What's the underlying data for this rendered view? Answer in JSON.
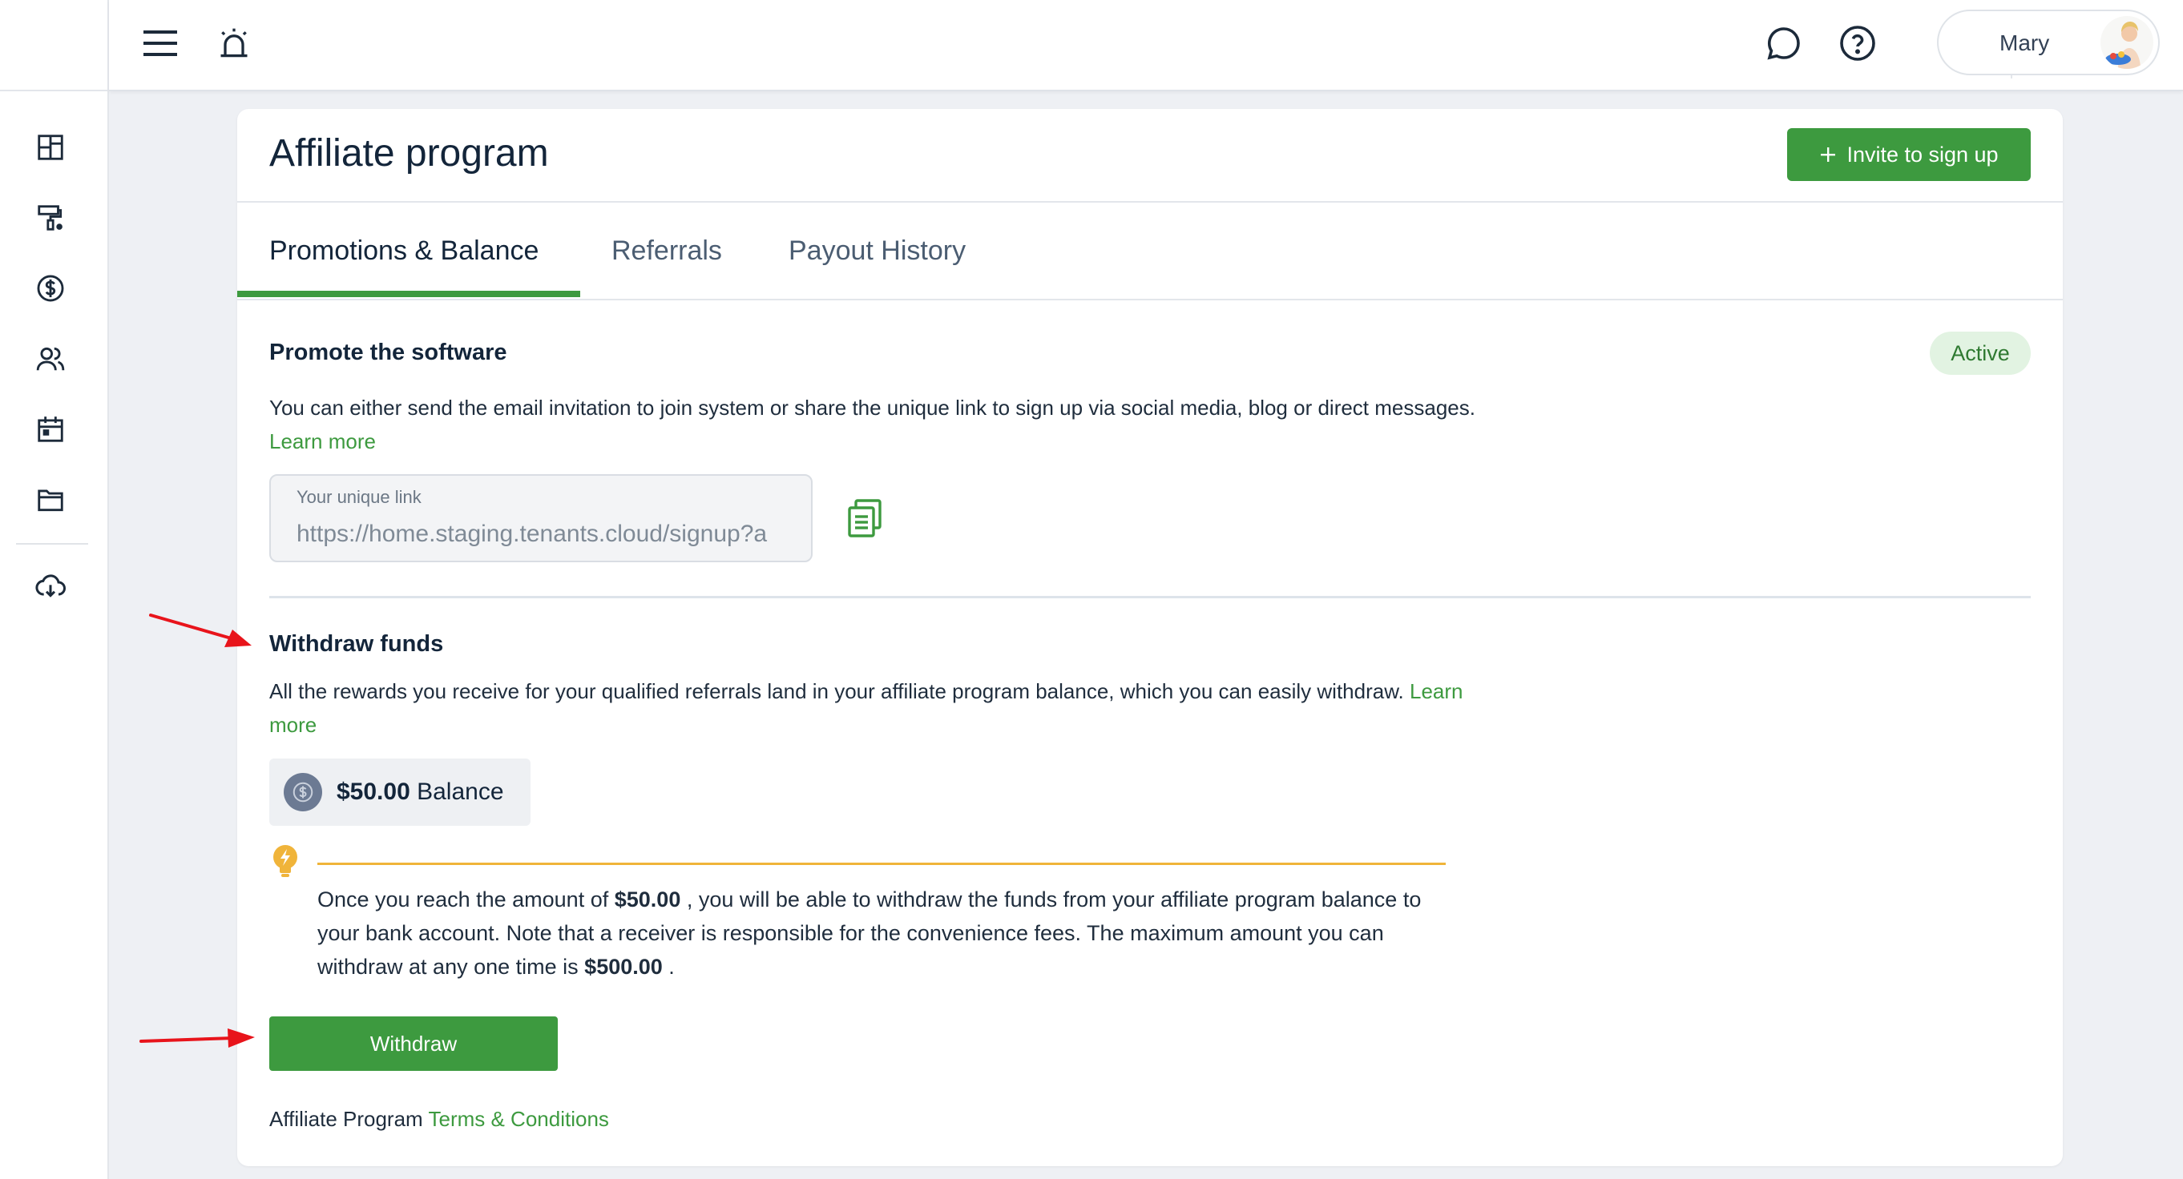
{
  "user": {
    "name": "Mary"
  },
  "page": {
    "title": "Affiliate program",
    "invite_button": "Invite to sign up"
  },
  "tabs": [
    {
      "label": "Promotions & Balance",
      "active": true
    },
    {
      "label": "Referrals",
      "active": false
    },
    {
      "label": "Payout History",
      "active": false
    }
  ],
  "promote": {
    "title": "Promote the software",
    "status": "Active",
    "description": "You can either send the email invitation to join system or share the unique link to sign up via social media, blog or direct messages.",
    "learn_more": "Learn more",
    "link_label": "Your unique link",
    "link_value": "https://home.staging.tenants.cloud/signup?a"
  },
  "withdraw": {
    "title": "Withdraw funds",
    "description": "All the rewards you receive for your qualified referrals land in your affiliate program balance, which you can easily withdraw.",
    "learn_more": "Learn more",
    "balance_amount": "$50.00",
    "balance_label": "Balance",
    "note_part1": "Once you reach the amount of",
    "note_min": "$50.00",
    "note_part2": ", you will be able to withdraw the funds from your affiliate program balance to your bank account. Note that a receiver is responsible for the convenience fees. The maximum amount you can withdraw at any one time is",
    "note_max": "$500.00",
    "note_end": ".",
    "button": "Withdraw"
  },
  "terms": {
    "prefix": "Affiliate Program",
    "link": "Terms & Conditions"
  },
  "colors": {
    "accent": "#3d9a3f",
    "badge_bg": "#e2f3e2",
    "note_line": "#f0b43a",
    "annotation_arrow": "#e8141b"
  },
  "icons": {
    "sidebar": [
      "dashboard-icon",
      "paint-roller-icon",
      "dollar-circle-icon",
      "users-icon",
      "calendar-icon",
      "folder-icon",
      "cloud-download-icon"
    ],
    "topbar": [
      "hamburger-menu-icon",
      "alarm-icon",
      "chat-bubble-icon",
      "help-circle-icon"
    ]
  }
}
